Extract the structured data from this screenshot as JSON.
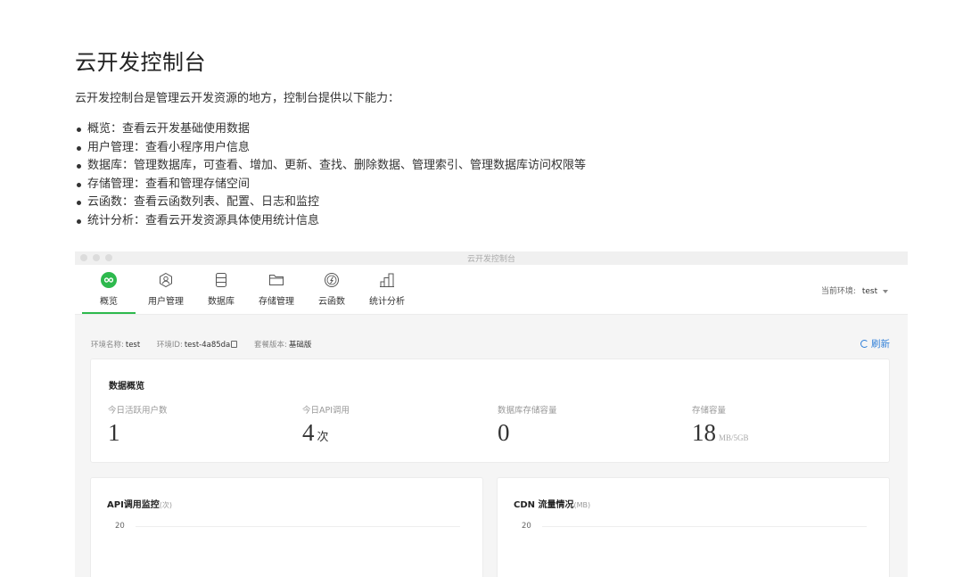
{
  "doc": {
    "title": "云开发控制台",
    "intro": "云开发控制台是管理云开发资源的地方，控制台提供以下能力：",
    "features": [
      "概览：查看云开发基础使用数据",
      "用户管理：查看小程序用户信息",
      "数据库：管理数据库，可查看、增加、更新、查找、删除数据、管理索引、管理数据库访问权限等",
      "存储管理：查看和管理存储空间",
      "云函数：查看云函数列表、配置、日志和监控",
      "统计分析：查看云开发资源具体使用统计信息"
    ]
  },
  "window": {
    "title": "云开发控制台",
    "tabs": [
      {
        "label": "概览",
        "icon": "infinity-icon",
        "active": true
      },
      {
        "label": "用户管理",
        "icon": "user-icon"
      },
      {
        "label": "数据库",
        "icon": "database-icon"
      },
      {
        "label": "存储管理",
        "icon": "folder-icon"
      },
      {
        "label": "云函数",
        "icon": "cloud-function-icon"
      },
      {
        "label": "统计分析",
        "icon": "bar-chart-icon"
      }
    ],
    "env_label": "当前环境:",
    "env_value": "test",
    "accent_color": "#2db94d",
    "link_color": "#2f7fd8"
  },
  "envbar": {
    "name_label": "环境名称:",
    "name_value": "test",
    "id_label": "环境ID:",
    "id_value": "test-4a85da",
    "plan_label": "套餐版本:",
    "plan_value": "基础版",
    "refresh_label": "刷新"
  },
  "overview": {
    "title": "数据概览",
    "stats": [
      {
        "label": "今日活跃用户数",
        "value": "1",
        "unit": ""
      },
      {
        "label": "今日API调用",
        "value": "4",
        "unit": "次"
      },
      {
        "label": "数据库存储容量",
        "value": "0",
        "unit": ""
      },
      {
        "label": "存储容量",
        "value": "18",
        "unit": "MB/5GB"
      }
    ]
  },
  "charts": [
    {
      "title": "API调用监控",
      "unit": "(次)",
      "tick": "20"
    },
    {
      "title": "CDN 流量情况",
      "unit": "(MB)",
      "tick": "20"
    }
  ]
}
